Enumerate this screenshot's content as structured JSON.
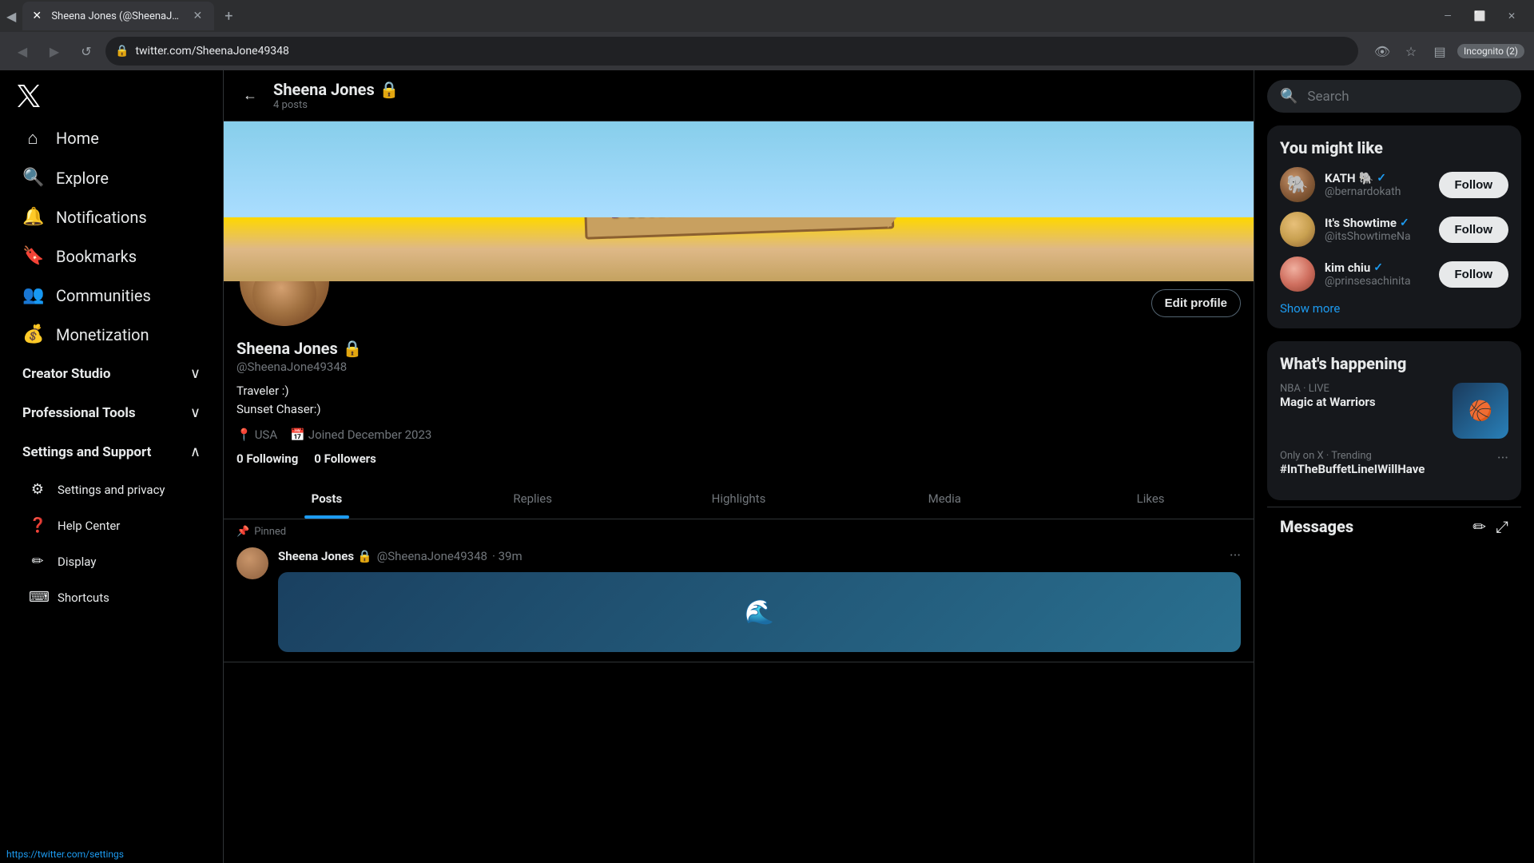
{
  "browser": {
    "tab": {
      "title": "Sheena Jones (@SheenaJone49...",
      "favicon": "✕",
      "close": "✕"
    },
    "new_tab": "+",
    "window_controls": {
      "minimize": "—",
      "maximize": "⬜",
      "close": "✕"
    },
    "address": "twitter.com/SheenaJone49348",
    "incognito_label": "Incognito (2)"
  },
  "sidebar": {
    "logo": "✕",
    "nav_items": [
      {
        "label": "Home",
        "icon": "⌂"
      },
      {
        "label": "Explore",
        "icon": "⌕"
      },
      {
        "label": "Notifications",
        "icon": "🔔"
      },
      {
        "label": "Bookmarks",
        "icon": "🔖"
      },
      {
        "label": "Communities",
        "icon": "👥"
      },
      {
        "label": "Monetization",
        "icon": "💰"
      }
    ],
    "expandable": [
      {
        "label": "Creator Studio",
        "expanded": false
      },
      {
        "label": "Professional Tools",
        "expanded": false
      },
      {
        "label": "Settings and Support",
        "expanded": true
      }
    ],
    "sub_items": [
      {
        "label": "Settings and privacy",
        "icon": "⚙"
      },
      {
        "label": "Help Center",
        "icon": "?"
      },
      {
        "label": "Display",
        "icon": "✏"
      },
      {
        "label": "Shortcuts",
        "icon": "⌨"
      }
    ]
  },
  "profile": {
    "back_arrow": "←",
    "name": "Sheena Jones",
    "lock_icon": "🔒",
    "posts_count": "4 posts",
    "banner_text": "TIME TO TRAVEL",
    "username": "@SheenaJone49348",
    "bio_line1": "Traveler :)",
    "bio_line2": "Sunset Chaser:)",
    "location": "USA",
    "joined": "Joined December 2023",
    "calendar_icon": "📅",
    "location_icon": "📍",
    "following_count": "0",
    "following_label": "Following",
    "followers_count": "0",
    "followers_label": "Followers",
    "edit_profile_label": "Edit profile",
    "tabs": [
      {
        "label": "Posts",
        "active": true
      },
      {
        "label": "Replies",
        "active": false
      },
      {
        "label": "Highlights",
        "active": false
      },
      {
        "label": "Media",
        "active": false
      },
      {
        "label": "Likes",
        "active": false
      }
    ],
    "pinned_label": "Pinned",
    "post": {
      "name": "Sheena Jones",
      "lock": "🔒",
      "handle": "@SheenaJone49348",
      "time": "39m",
      "more": "···"
    }
  },
  "right_sidebar": {
    "search_placeholder": "Search",
    "you_might_like_title": "You might like",
    "suggestions": [
      {
        "name": "KATH",
        "emoji": "🐘",
        "verified": true,
        "handle": "@bernardokath",
        "follow_label": "Follow",
        "avatar_class": "avatar-kath"
      },
      {
        "name": "It's Showtime",
        "emoji": "",
        "verified": true,
        "handle": "@itsShowtimeNa",
        "follow_label": "Follow",
        "avatar_class": "avatar-showtime"
      },
      {
        "name": "kim chiu",
        "emoji": "",
        "verified": true,
        "handle": "@prinsesachinita",
        "follow_label": "Follow",
        "avatar_class": "avatar-kimchiu"
      }
    ],
    "show_more": "Show more",
    "what_happening_title": "What's happening",
    "trending": [
      {
        "context": "NBA · LIVE",
        "label": "Magic at Warriors",
        "has_image": true
      },
      {
        "context": "Only on X · Trending",
        "label": "#InTheBuffetLineIWillHave",
        "has_image": false,
        "more_icon": "···"
      }
    ],
    "messages_title": "Messages"
  },
  "status_bar": {
    "url": "https://twitter.com/settings"
  }
}
